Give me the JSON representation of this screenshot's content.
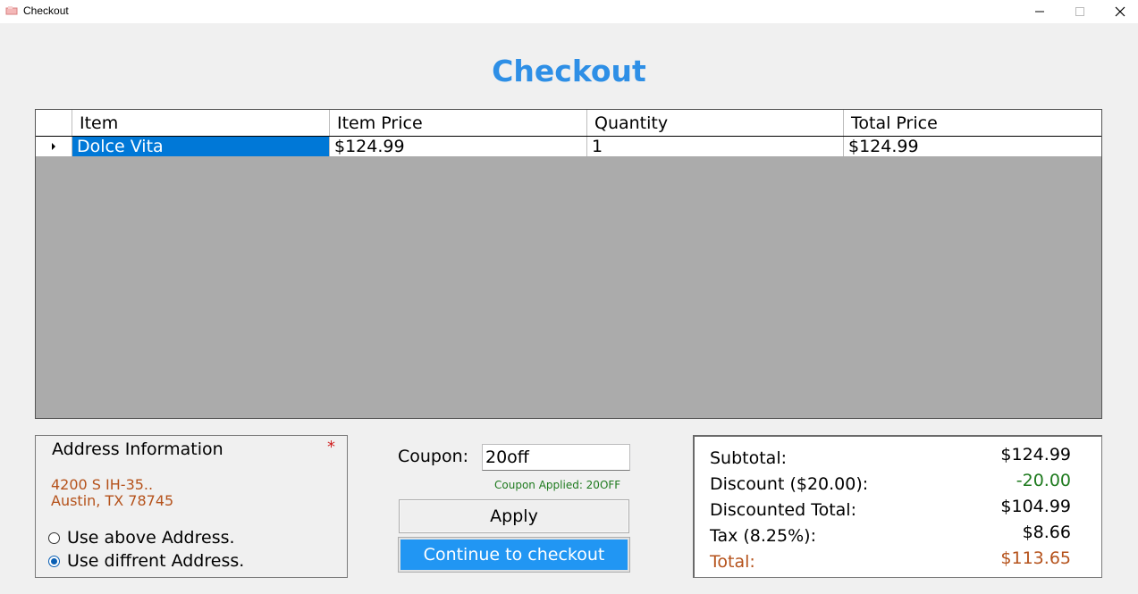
{
  "window": {
    "title": "Checkout",
    "icon": "app-icon",
    "controls": {
      "minimize": "minimize-icon",
      "maximize": "maximize-icon",
      "close": "close-icon"
    }
  },
  "heading": "Checkout",
  "grid": {
    "columns": [
      "Item",
      "Item Price",
      "Quantity",
      "Total Price"
    ],
    "rows": [
      {
        "item": "Dolce Vita",
        "item_price": "$124.99",
        "quantity": "1",
        "total_price": "$124.99"
      }
    ],
    "selected_row": 0
  },
  "address": {
    "title": "Address Information",
    "required_mark": "*",
    "line1": "4200 S IH-35..",
    "line2": "Austin, TX 78745",
    "options": [
      {
        "label": "Use above Address.",
        "checked": false
      },
      {
        "label": "Use diffrent Address.",
        "checked": true
      }
    ]
  },
  "coupon": {
    "label": "Coupon:",
    "value": "20off",
    "status": "Coupon Applied: 20OFF",
    "apply_label": "Apply",
    "checkout_label": "Continue to checkout"
  },
  "summary": {
    "subtotal_label": "Subtotal:",
    "subtotal_value": "$124.99",
    "discount_label": "Discount ($20.00):",
    "discount_value": "-20.00",
    "discounted_total_label": "Discounted Total:",
    "discounted_total_value": "$104.99",
    "tax_label": "Tax (8.25%):",
    "tax_value": "$8.66",
    "total_label": "Total:",
    "total_value": "$113.65"
  },
  "colors": {
    "heading": "#2e8fe6",
    "selection": "#0078d7",
    "checkout_button": "#2196f3",
    "address_text": "#b5521b",
    "discount": "#1e7a1e",
    "required": "#d02020"
  }
}
